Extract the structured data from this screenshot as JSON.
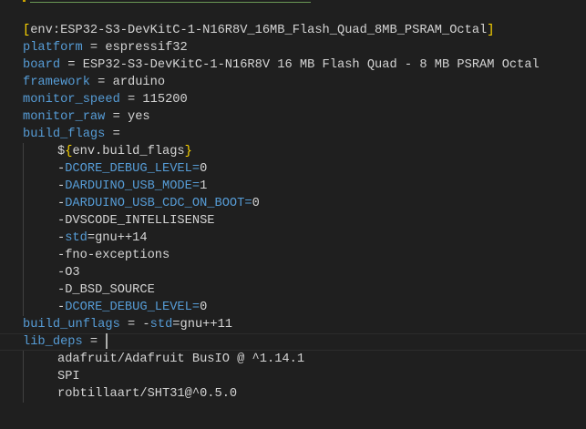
{
  "colors": {
    "background": "#1f1f1f",
    "key": "#569cd6",
    "text": "#d4d4d4",
    "bracket": "#ffd700"
  },
  "editor": {
    "cursor_line": 19,
    "lines": [
      {
        "indent": false,
        "segs": [
          {
            "t": "[",
            "c": "y"
          },
          {
            "t": "env:ESP32-S3-DevKitC-1-N16R8V_16MB_Flash_Quad_8MB_PSRAM_Octal",
            "c": "v"
          },
          {
            "t": "]",
            "c": "y"
          }
        ]
      },
      {
        "indent": false,
        "segs": [
          {
            "t": "platform",
            "c": "k"
          },
          {
            "t": " = espressif32",
            "c": "v"
          }
        ]
      },
      {
        "indent": false,
        "segs": [
          {
            "t": "board",
            "c": "k"
          },
          {
            "t": " = ESP32-S3-DevKitC-1-N16R8V 16 MB Flash Quad - 8 MB PSRAM Octal",
            "c": "v"
          }
        ]
      },
      {
        "indent": false,
        "segs": [
          {
            "t": "framework",
            "c": "k"
          },
          {
            "t": " = arduino",
            "c": "v"
          }
        ]
      },
      {
        "indent": false,
        "segs": [
          {
            "t": "monitor_speed",
            "c": "k"
          },
          {
            "t": " = 115200",
            "c": "v"
          }
        ]
      },
      {
        "indent": false,
        "segs": [
          {
            "t": "monitor_raw",
            "c": "k"
          },
          {
            "t": " = yes",
            "c": "v"
          }
        ]
      },
      {
        "indent": false,
        "segs": [
          {
            "t": "build_flags",
            "c": "k"
          },
          {
            "t": " =",
            "c": "v"
          }
        ]
      },
      {
        "indent": true,
        "segs": [
          {
            "t": "$",
            "c": "v"
          },
          {
            "t": "{",
            "c": "y"
          },
          {
            "t": "env.build_flags",
            "c": "v"
          },
          {
            "t": "}",
            "c": "y"
          }
        ]
      },
      {
        "indent": true,
        "segs": [
          {
            "t": "-",
            "c": "v"
          },
          {
            "t": "DCORE_DEBUG_LEVEL=",
            "c": "k"
          },
          {
            "t": "0",
            "c": "v"
          }
        ]
      },
      {
        "indent": true,
        "segs": [
          {
            "t": "-",
            "c": "v"
          },
          {
            "t": "DARDUINO_USB_MODE=",
            "c": "k"
          },
          {
            "t": "1",
            "c": "v"
          }
        ]
      },
      {
        "indent": true,
        "segs": [
          {
            "t": "-",
            "c": "v"
          },
          {
            "t": "DARDUINO_USB_CDC_ON_BOOT=",
            "c": "k"
          },
          {
            "t": "0",
            "c": "v"
          }
        ]
      },
      {
        "indent": true,
        "segs": [
          {
            "t": "-DVSCODE_INTELLISENSE",
            "c": "v"
          }
        ]
      },
      {
        "indent": true,
        "segs": [
          {
            "t": "-",
            "c": "v"
          },
          {
            "t": "std",
            "c": "k"
          },
          {
            "t": "=gnu++14",
            "c": "v"
          }
        ]
      },
      {
        "indent": true,
        "segs": [
          {
            "t": "-fno-exceptions",
            "c": "v"
          }
        ]
      },
      {
        "indent": true,
        "segs": [
          {
            "t": "-O3",
            "c": "v"
          }
        ]
      },
      {
        "indent": true,
        "segs": [
          {
            "t": "-D_BSD_SOURCE",
            "c": "v"
          }
        ]
      },
      {
        "indent": true,
        "segs": [
          {
            "t": "-",
            "c": "v"
          },
          {
            "t": "DCORE_DEBUG_LEVEL=",
            "c": "k"
          },
          {
            "t": "0",
            "c": "v"
          }
        ]
      },
      {
        "indent": false,
        "segs": [
          {
            "t": "build_unflags",
            "c": "k"
          },
          {
            "t": " = -",
            "c": "v"
          },
          {
            "t": "std",
            "c": "k"
          },
          {
            "t": "=gnu++11",
            "c": "v"
          }
        ]
      },
      {
        "indent": false,
        "segs": [
          {
            "t": "lib_deps",
            "c": "k"
          },
          {
            "t": " =",
            "c": "v"
          }
        ]
      },
      {
        "indent": true,
        "segs": [
          {
            "t": "adafruit/Adafruit BusIO @ ^1.14.1",
            "c": "v"
          }
        ]
      },
      {
        "indent": true,
        "segs": [
          {
            "t": "SPI",
            "c": "v"
          }
        ]
      },
      {
        "indent": true,
        "segs": [
          {
            "t": "robtillaart/SHT31@^0.5.0",
            "c": "v"
          }
        ]
      }
    ]
  }
}
